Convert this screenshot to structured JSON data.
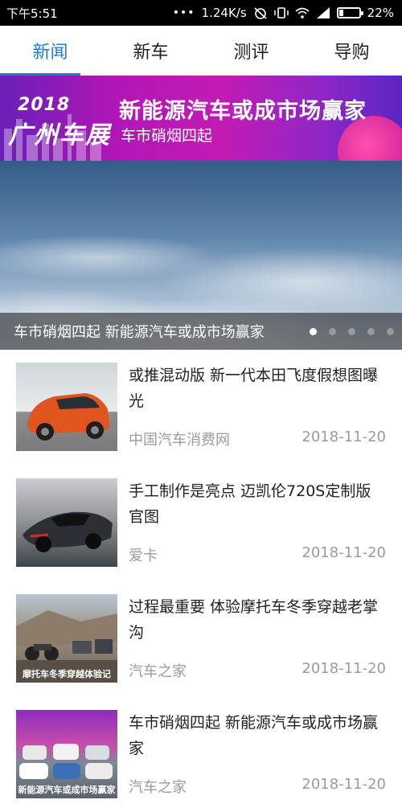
{
  "status_bar": {
    "time": "下午5:51",
    "dots": "•••",
    "net_speed": "1.24K/s",
    "battery": "22%",
    "battery_level": 0.22
  },
  "tabs": [
    {
      "label": "新闻",
      "active": true
    },
    {
      "label": "新车",
      "active": false
    },
    {
      "label": "测评",
      "active": false
    },
    {
      "label": "导购",
      "active": false
    }
  ],
  "banner": {
    "logo_year": "2018",
    "logo_name": "广州车展",
    "headline": "新能源汽车或成市场赢家",
    "subheadline": "车市硝烟四起",
    "caption": "车市硝烟四起 新能源汽车或成市场赢家",
    "slide_count": 5,
    "active_slide": 0
  },
  "news": [
    {
      "title": "或推混动版 新一代本田飞度假想图曝光",
      "source": "中国汽车消费网",
      "date": "2018-11-20"
    },
    {
      "title": "手工制作是亮点 迈凯伦720S定制版官图",
      "source": "爱卡",
      "date": "2018-11-20"
    },
    {
      "title": "过程最重要 体验摩托车冬季穿越老掌沟",
      "source": "汽车之家",
      "date": "2018-11-20",
      "thumb_label": "摩托车冬季穿越体验记"
    },
    {
      "title": "车市硝烟四起 新能源汽车或成市场赢家",
      "source": "汽车之家",
      "date": "2018-11-20",
      "thumb_label": "新能源汽车或成市场赢家"
    }
  ],
  "colors": {
    "accent": "#1e7ccf",
    "meta_text": "#9b9b9b",
    "status_bar_bg": "#000000"
  }
}
